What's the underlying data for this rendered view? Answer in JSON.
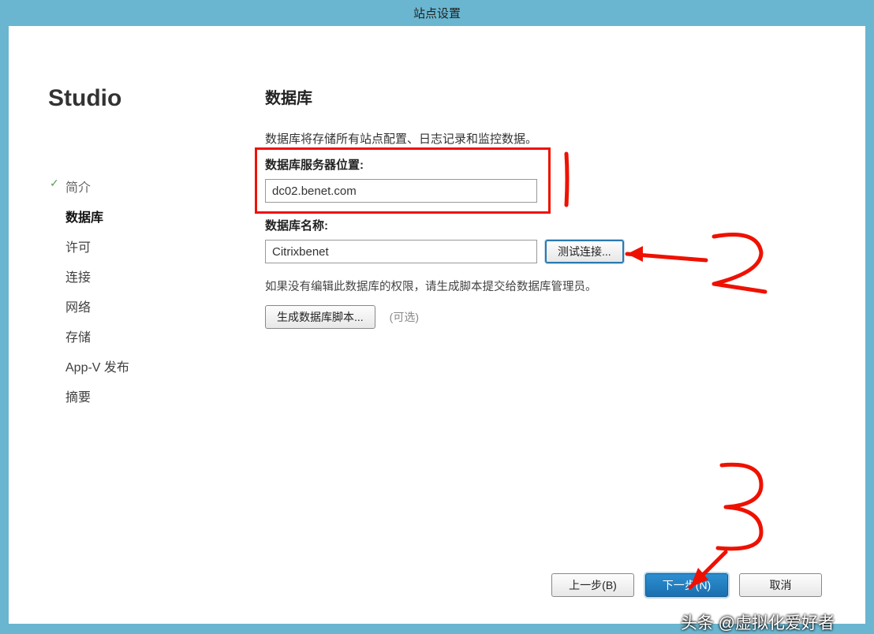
{
  "titlebar": "站点设置",
  "studio": "Studio",
  "steps": [
    {
      "label": "简介",
      "state": "done"
    },
    {
      "label": "数据库",
      "state": "current"
    },
    {
      "label": "许可",
      "state": ""
    },
    {
      "label": "连接",
      "state": ""
    },
    {
      "label": "网络",
      "state": ""
    },
    {
      "label": "存储",
      "state": ""
    },
    {
      "label": "App-V 发布",
      "state": ""
    },
    {
      "label": "摘要",
      "state": ""
    }
  ],
  "page": {
    "title": "数据库",
    "description": "数据库将存储所有站点配置、日志记录和监控数据。",
    "server_location": {
      "label": "数据库服务器位置:",
      "value": "dc02.benet.com"
    },
    "db_name": {
      "label": "数据库名称:",
      "value": "Citrixbenet",
      "test_button": "测试连接..."
    },
    "hint": "如果没有编辑此数据库的权限，请生成脚本提交给数据库管理员。",
    "generate_script_button": "生成数据库脚本...",
    "optional_label": "(可选)"
  },
  "footer": {
    "back": "上一步(B)",
    "next": "下一步(N)",
    "cancel": "取消"
  },
  "watermark": "头条 @虚拟化爱好者"
}
